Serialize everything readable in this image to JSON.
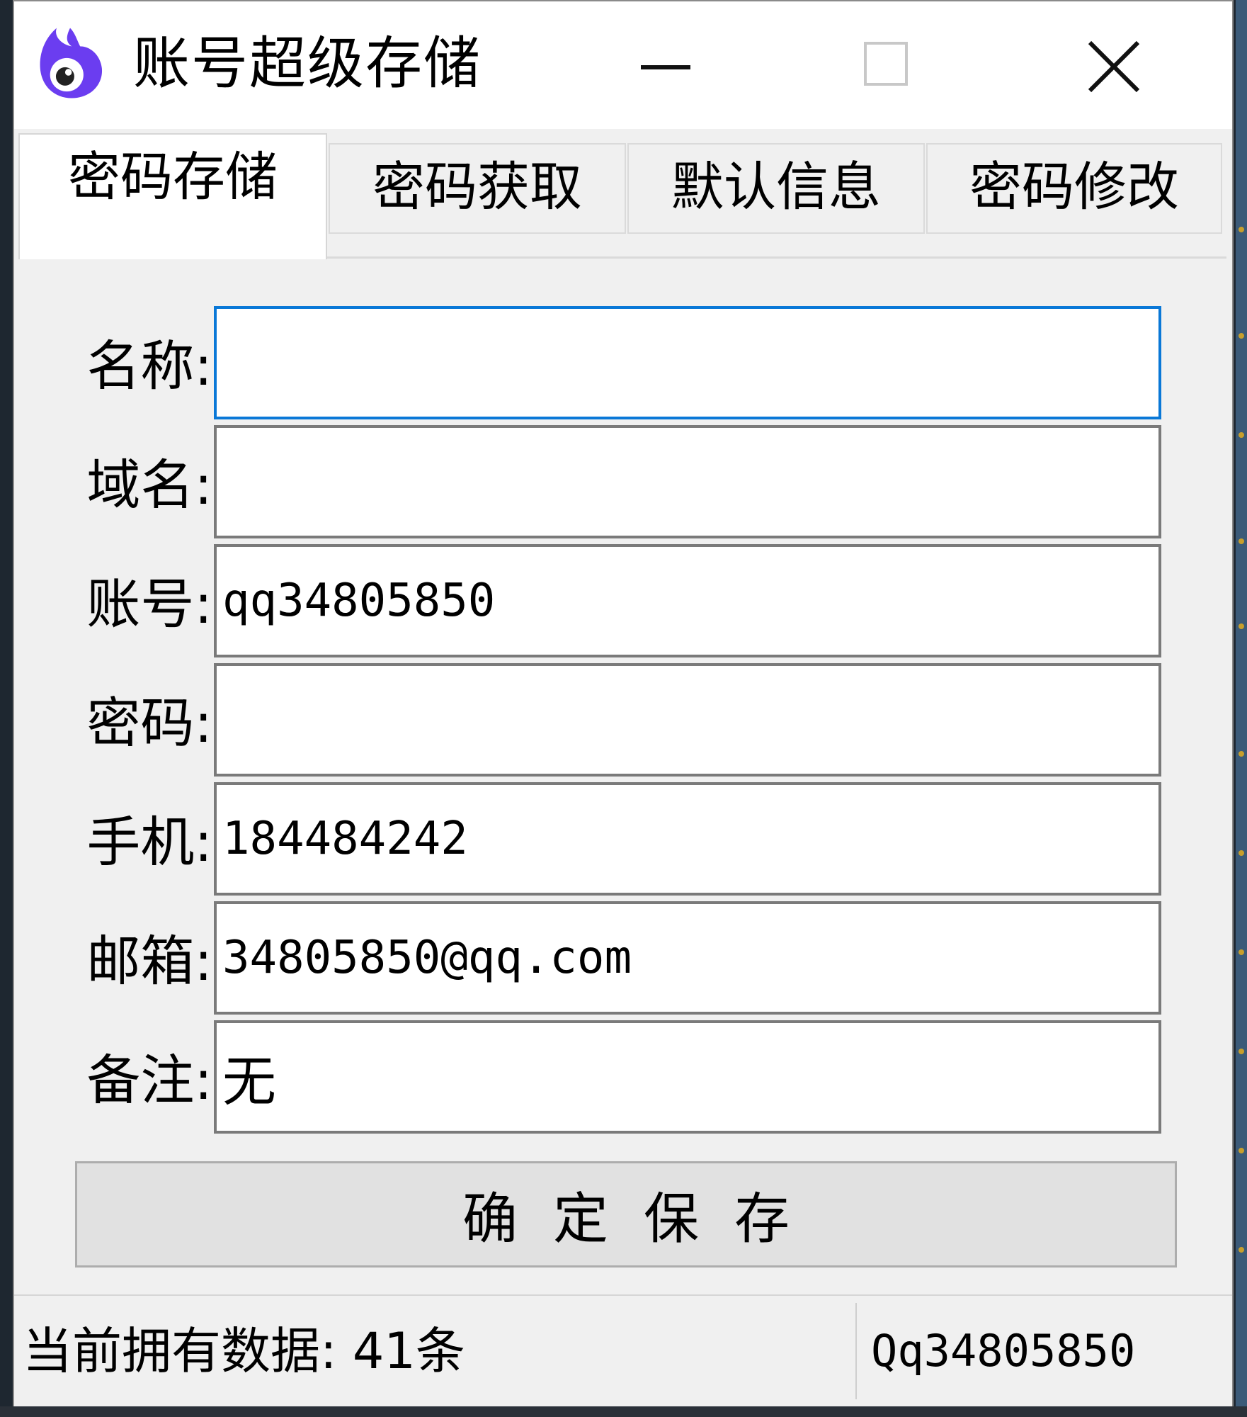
{
  "window": {
    "title": "账号超级存储",
    "icon": "app-logo-icon",
    "controls": {
      "minimize": "minimize-icon",
      "maximize": "maximize-icon",
      "close": "close-icon"
    }
  },
  "tabs": [
    {
      "label": "密码存储",
      "active": true
    },
    {
      "label": "密码获取",
      "active": false
    },
    {
      "label": "默认信息",
      "active": false
    },
    {
      "label": "密码修改",
      "active": false
    }
  ],
  "form": {
    "fields": [
      {
        "label": "名称:",
        "value": ""
      },
      {
        "label": "域名:",
        "value": ""
      },
      {
        "label": "账号:",
        "value": "qq34805850"
      },
      {
        "label": "密码:",
        "value": ""
      },
      {
        "label": "手机:",
        "value": "184484242"
      },
      {
        "label": "邮箱:",
        "value": "34805850@qq.com"
      },
      {
        "label": "备注:",
        "value": "无"
      }
    ],
    "save_label": "确定保存"
  },
  "status": {
    "left": "当前拥有数据: 41条",
    "right": "Qq34805850"
  },
  "colors": {
    "focus_border": "#0a78d7",
    "app_icon": "#6b3df0",
    "window_bg": "#f0f0f0"
  }
}
